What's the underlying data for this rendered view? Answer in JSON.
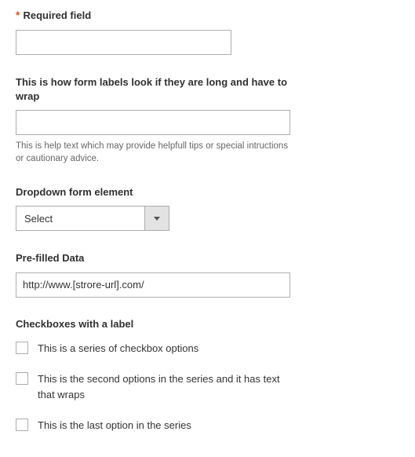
{
  "fields": {
    "required": {
      "asterisk": "*",
      "label": "Required field",
      "value": ""
    },
    "longLabel": {
      "label": "This is how form labels look if they are long and have to wrap",
      "value": "",
      "help": "This is help text which may provide helpfull tips or special intructions or cautionary advice."
    },
    "dropdown": {
      "label": "Dropdown form element",
      "selected": "Select"
    },
    "prefilled": {
      "label": "Pre-filled Data",
      "value": "http://www.[strore-url].com/"
    }
  },
  "checkboxes": {
    "label": "Checkboxes with a label",
    "items": [
      {
        "label": "This is a series of checkbox options",
        "checked": false
      },
      {
        "label": "This is the second options in the series and it has text that wraps",
        "checked": false
      },
      {
        "label": "This is the last option in the series",
        "checked": false
      }
    ]
  }
}
